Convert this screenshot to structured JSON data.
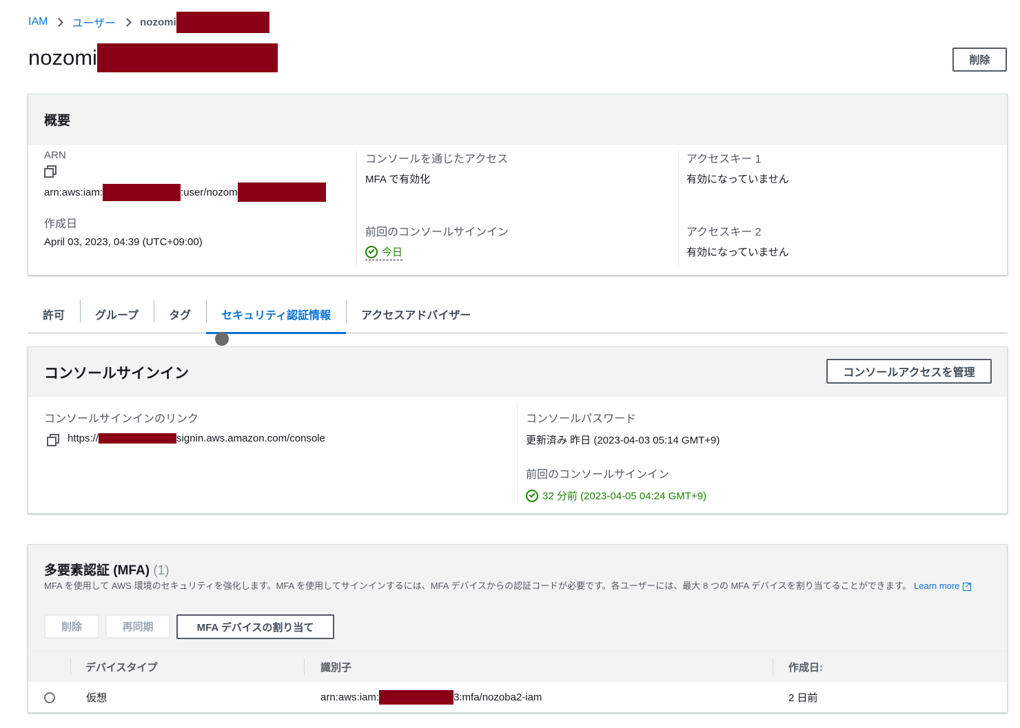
{
  "breadcrumb": {
    "root": "IAM",
    "users": "ユーザー",
    "current": "nozomi"
  },
  "page": {
    "title": "nozomi",
    "delete_button": "削除"
  },
  "summary": {
    "title": "概要",
    "arn_label": "ARN",
    "arn_prefix": "arn:aws:iam:",
    "arn_mid": ":user/nozom",
    "created_label": "作成日",
    "created_value": "April 03, 2023, 04:39 (UTC+09:00)",
    "console_access_label": "コンソールを通じたアクセス",
    "console_access_value": "MFA で有効化",
    "last_signin_label": "前回のコンソールサインイン",
    "last_signin_value": "今日",
    "access_key1_label": "アクセスキー 1",
    "access_key1_value": "有効になっていません",
    "access_key2_label": "アクセスキー 2",
    "access_key2_value": "有効になっていません"
  },
  "tabs": [
    "許可",
    "グループ",
    "タグ",
    "セキュリティ認証情報",
    "アクセスアドバイザー"
  ],
  "active_tab": "セキュリティ認証情報",
  "console_signin": {
    "title": "コンソールサインイン",
    "manage_button": "コンソールアクセスを管理",
    "link_label": "コンソールサインインのリンク",
    "link_prefix": "https://",
    "link_suffix": "signin.aws.amazon.com/console",
    "password_label": "コンソールパスワード",
    "password_value": "更新済み 昨日 (2023-04-03 05:14 GMT+9)",
    "last_signin_label": "前回のコンソールサインイン",
    "last_signin_value": "32 分前 (2023-04-05 04:24 GMT+9)"
  },
  "mfa": {
    "title": "多要素認証 (MFA)",
    "count": "(1)",
    "description": "MFA を使用して AWS 環境のセキュリティを強化します。MFA を使用してサインインするには、MFA デバイスからの認証コードが必要です。各ユーザーには、最大 8 つの MFA デバイスを割り当てることができます。",
    "learn_more": "Learn more",
    "delete_button": "削除",
    "resync_button": "再同期",
    "assign_button": "MFA デバイスの割り当て",
    "columns": [
      "デバイスタイプ",
      "識別子",
      "作成日:"
    ],
    "rows": [
      {
        "type": "仮想",
        "id_prefix": "arn:aws:iam:",
        "id_suffix": "3:mfa/nozoba2-iam",
        "created": "2 日前"
      }
    ]
  },
  "colors": {
    "accent": "#0972d3",
    "success": "#1d8102",
    "redaction": "#8a0016"
  }
}
